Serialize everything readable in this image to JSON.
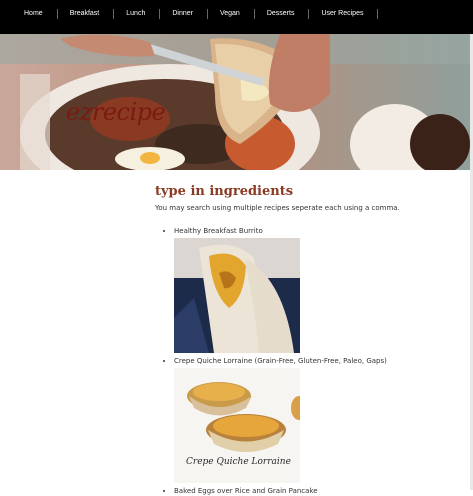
{
  "nav": {
    "items": [
      {
        "label": "Home"
      },
      {
        "label": "Breakfast"
      },
      {
        "label": "Lunch"
      },
      {
        "label": "Dinner"
      },
      {
        "label": "Vegan"
      },
      {
        "label": "Desserts"
      },
      {
        "label": "User Recipes"
      }
    ]
  },
  "hero": {
    "logo_text": "ezrecipe"
  },
  "search": {
    "heading": "type in ingredients",
    "hint": "You may search using multiple recipes seperate each using a comma."
  },
  "results": [
    {
      "title": "Healthy Breakfast Burrito"
    },
    {
      "title": "Crepe Quiche Lorraine (Grain-Free, Gluten-Free, Paleo, Gaps)",
      "image_caption": "Crepe Quiche Lorraine"
    },
    {
      "title": "Baked Eggs over Rice and Grain Pancake"
    }
  ],
  "colors": {
    "nav_bg": "#000000",
    "heading": "#8a3a22",
    "logo": "#7a1a12"
  }
}
